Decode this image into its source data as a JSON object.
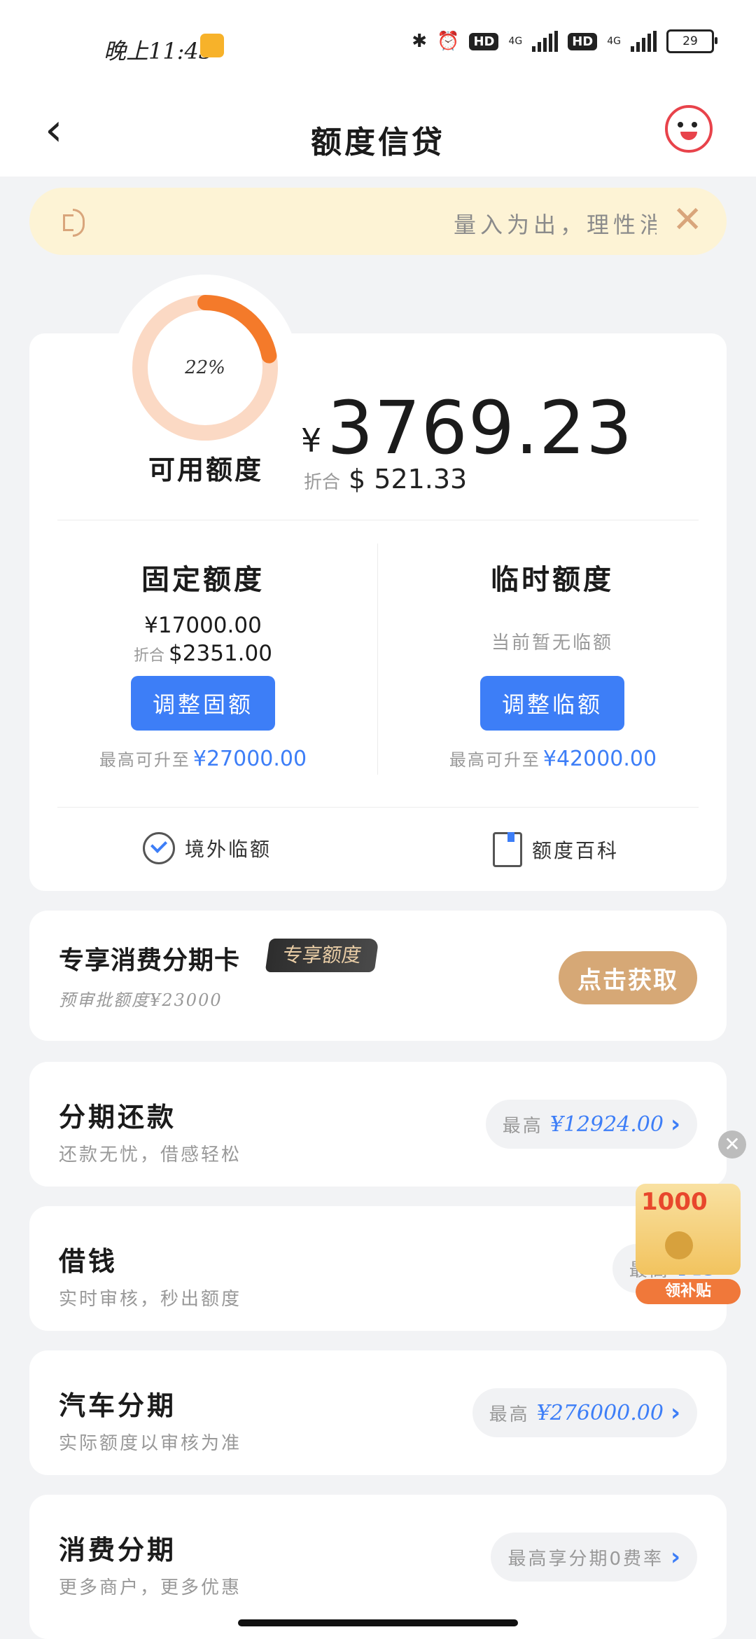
{
  "status_bar": {
    "time": "晚上11:43",
    "battery": "29",
    "net1": "4G",
    "net2": "4G"
  },
  "header": {
    "title": "额度信贷"
  },
  "notice": {
    "text": "量入为出，理性消费"
  },
  "credit": {
    "donut_pct": "22%",
    "donut_fraction": 0.22,
    "available_label": "可用额度",
    "currency": "¥",
    "available": "3769.23",
    "usd_label": "折合",
    "usd_value": "$ 521.33",
    "fixed": {
      "title": "固定额度",
      "amount": "¥17000.00",
      "usd_label": "折合",
      "usd": "$2351.00",
      "button": "调整固额",
      "max_label": "最高可升至",
      "max": "¥27000.00"
    },
    "temp": {
      "title": "临时额度",
      "none_text": "当前暂无临额",
      "button": "调整临额",
      "max_label": "最高可升至",
      "max": "¥42000.00"
    },
    "links": {
      "abroad": "境外临额",
      "wiki": "额度百科"
    }
  },
  "exclusive": {
    "title": "专享消费分期卡",
    "tag": "专享额度",
    "sub": "预审批额度¥23000",
    "button": "点击获取"
  },
  "products": [
    {
      "name": "分期还款",
      "desc": "还款无忧，借感轻松",
      "max_label": "最高",
      "max": "¥12924.00"
    },
    {
      "name": "借钱",
      "desc": "实时审核，秒出额度",
      "max_label": "最高",
      "max": "¥43"
    },
    {
      "name": "汽车分期",
      "desc": "实际额度以审核为准",
      "max_label": "最高",
      "max": "¥276000.00"
    },
    {
      "name": "消费分期",
      "desc": "更多商户，更多优惠",
      "max_label": "最高享分期0费率",
      "max": ""
    }
  ],
  "promo": {
    "amount": "1000",
    "button": "领补贴"
  },
  "colors": {
    "accent": "#3d7ef7",
    "orange": "#f47a2a",
    "gold": "#d6a876"
  }
}
